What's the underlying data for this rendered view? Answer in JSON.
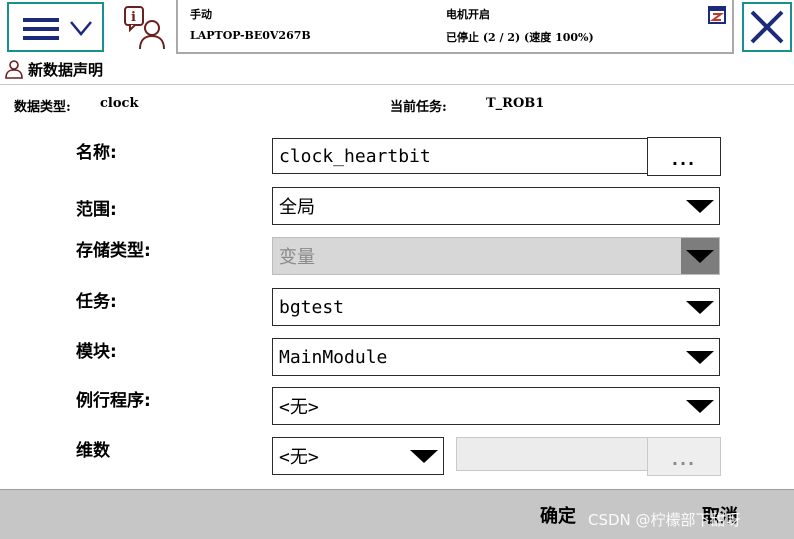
{
  "status": {
    "mode": "手动",
    "controller": "LAPTOP-BE0V267B",
    "motor_state": "电机开启",
    "program_state": "已停止 (2 / 2) (速度 100%)"
  },
  "window_title": "新数据声明",
  "info": {
    "data_type_label": "数据类型:",
    "data_type_value": "clock",
    "current_task_label": "当前任务:",
    "current_task_value": "T_ROB1"
  },
  "form": {
    "name": {
      "label": "名称:",
      "value": "clock_heartbit",
      "button": "..."
    },
    "scope": {
      "label": "范围:",
      "value": "全局"
    },
    "storage_type": {
      "label": "存储类型:",
      "value": "变量"
    },
    "task": {
      "label": "任务:",
      "value": "bgtest"
    },
    "module": {
      "label": "模块:",
      "value": "MainModule"
    },
    "routine": {
      "label": "例行程序:",
      "value": "<无>"
    },
    "dimensions": {
      "label": "维数",
      "value": "<无>",
      "button": "..."
    }
  },
  "buttons": {
    "ok": "确定",
    "cancel": "取消"
  },
  "watermark": "CSDN @柠檬部下甜呀",
  "colors": {
    "accent_border": "#1a8f8f",
    "icon_navy": "#1b2a7a",
    "bottom_bar": "#c6c6c6",
    "disabled_field": "#d7d7d7"
  }
}
